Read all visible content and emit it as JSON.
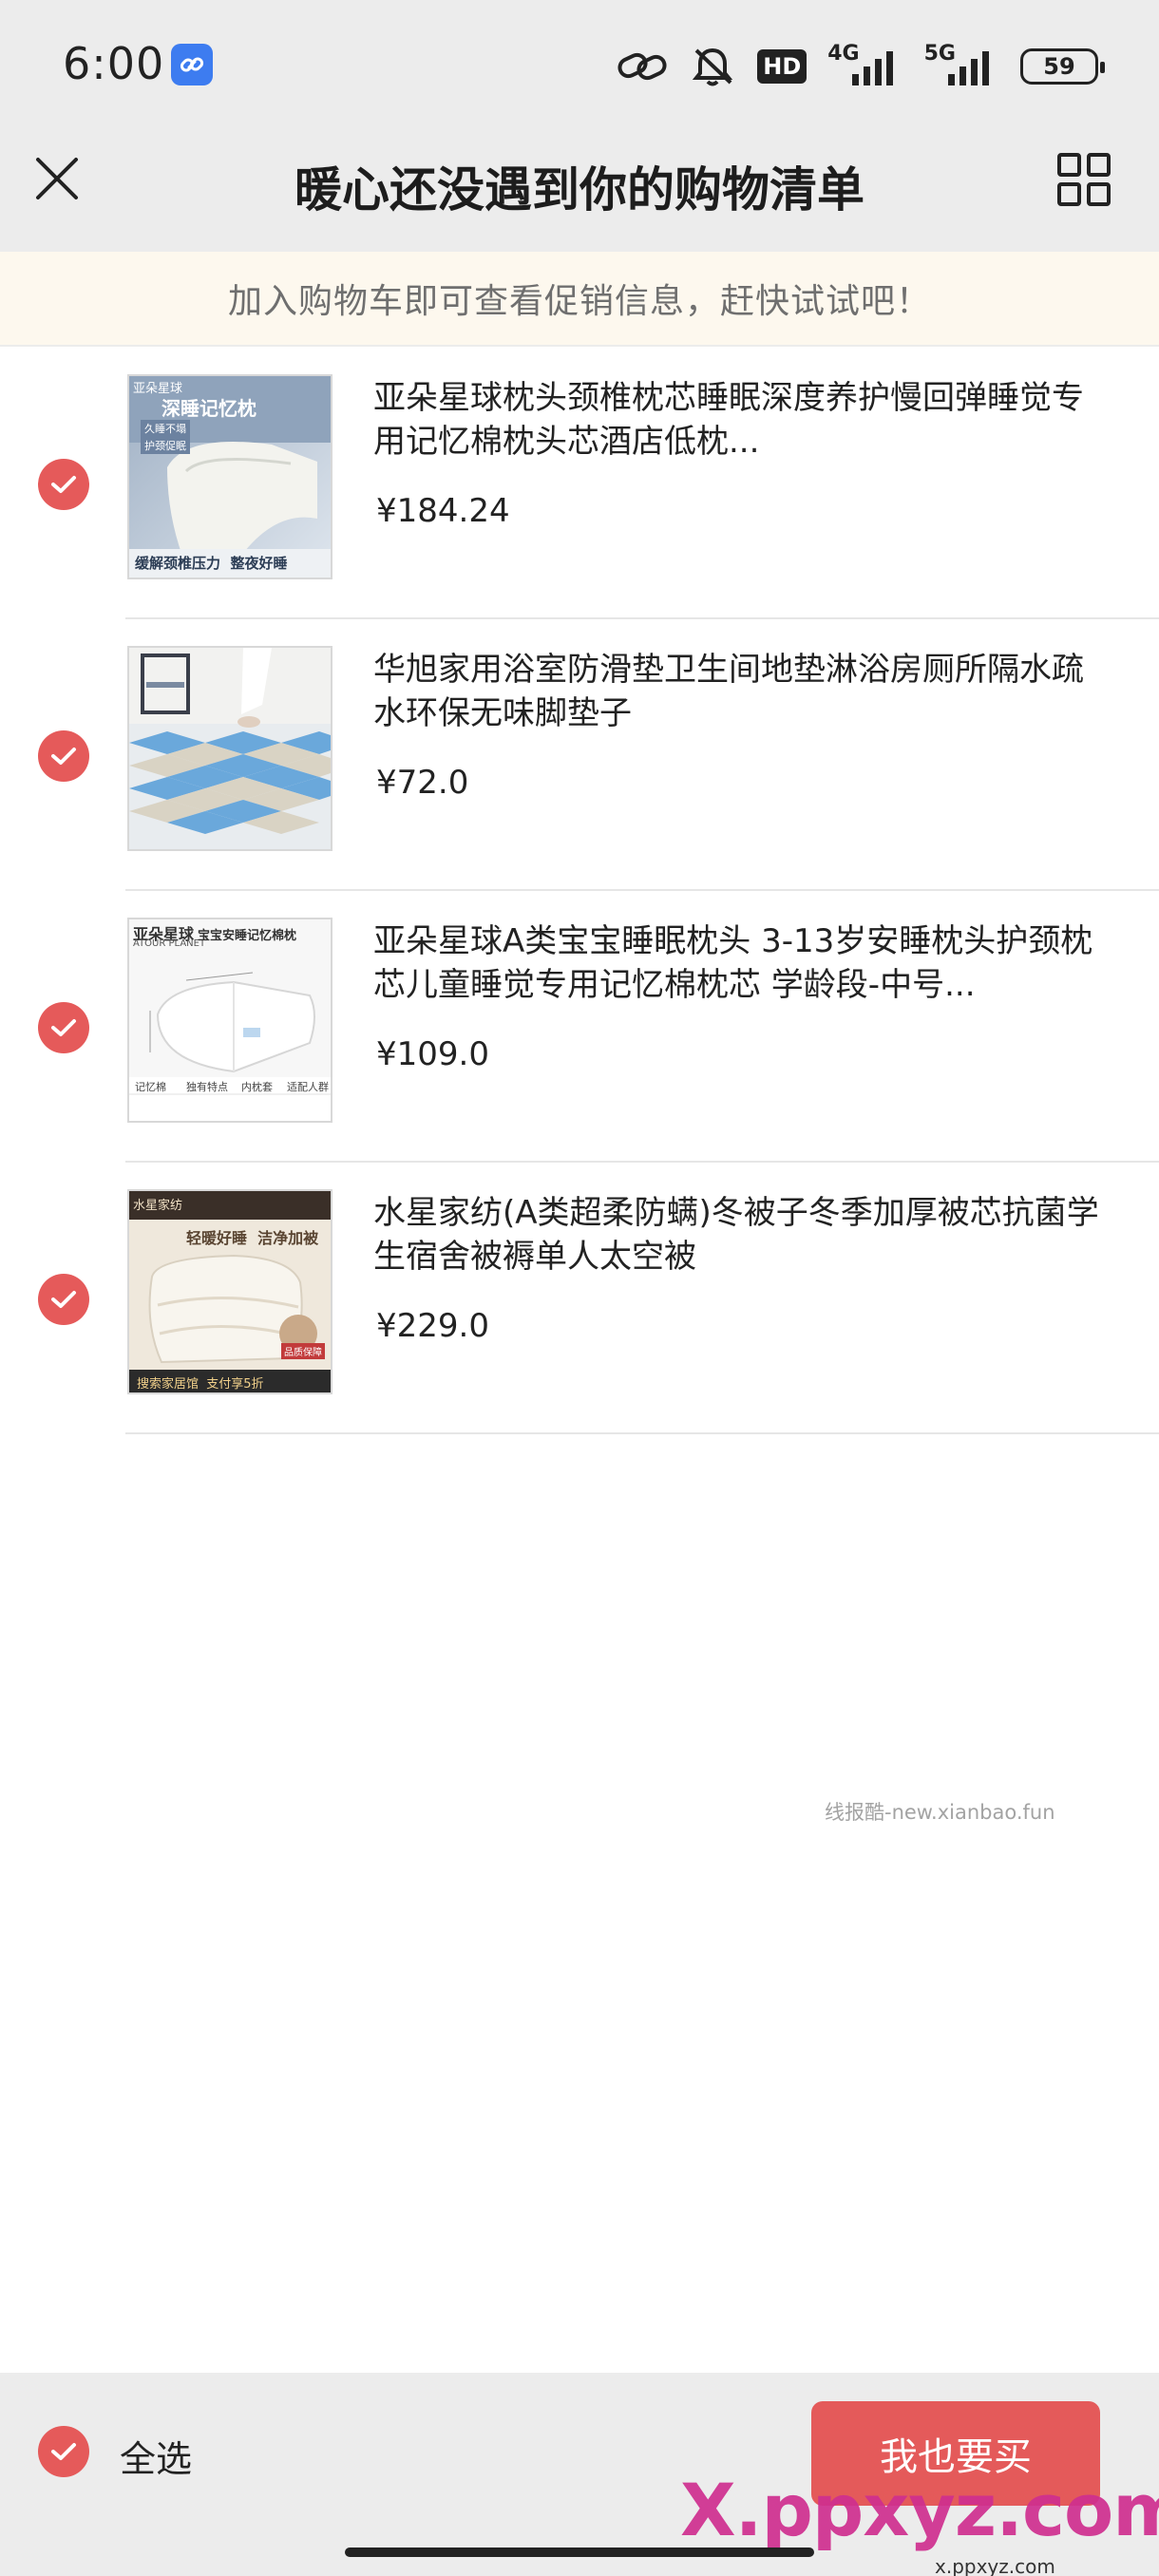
{
  "status_bar": {
    "time": "6:00",
    "network_4g": "4G",
    "network_5g": "5G",
    "hd": "HD",
    "battery": "59"
  },
  "header": {
    "title": "暖心还没遇到你的购物清单"
  },
  "promo": {
    "text": "加入购物车即可查看促销信息，赶快试试吧！"
  },
  "items": [
    {
      "title": "亚朵星球枕头颈椎枕芯睡眠深度养护慢回弹睡觉专用记忆棉枕头芯酒店低枕...",
      "price": "¥184.24",
      "checked": true
    },
    {
      "title": "华旭家用浴室防滑垫卫生间地垫淋浴房厕所隔水疏水环保无味脚垫子",
      "price": "¥72.0",
      "checked": true
    },
    {
      "title": "亚朵星球A类宝宝睡眠枕头 3-13岁安睡枕头护颈枕芯儿童睡觉专用记忆棉枕芯 学龄段-中号...",
      "price": "¥109.0",
      "checked": true
    },
    {
      "title": "水星家纺(A类超柔防螨)冬被子冬季加厚被芯抗菌学生宿舍被褥单人太空被",
      "price": "¥229.0",
      "checked": true
    }
  ],
  "thumbnails": {
    "item1": {
      "brand": "亚朵星球",
      "headline": "深睡记忆枕",
      "tag1": "久睡不塌",
      "tag2": "护颈促眠",
      "footer": "缓解颈椎压力  整夜好睡"
    },
    "item3": {
      "brand": "亚朵星球",
      "sub": "ATOUR PLANET",
      "headline": "宝宝安睡记忆棉枕",
      "row1": "记忆棉",
      "row2": "独有特点",
      "row3": "内枕套",
      "row4": "适配人群"
    },
    "item4": {
      "brand": "水星家纺",
      "headline": "轻暖好睡  洁净加被",
      "badge": "品质保障",
      "footer": "搜索家居馆  支付享5折"
    }
  },
  "watermark": "线报酷-new.xianbao.fun",
  "footer": {
    "select_all": "全选",
    "buy_button": "我也要买",
    "overlay_logo": "X.ppxyz.com",
    "overlay_sub": "x.ppxyz.com"
  },
  "colors": {
    "accent_red": "#e55a5a",
    "promo_bg": "#fdf8ee",
    "chrome_bg": "#ececec"
  }
}
